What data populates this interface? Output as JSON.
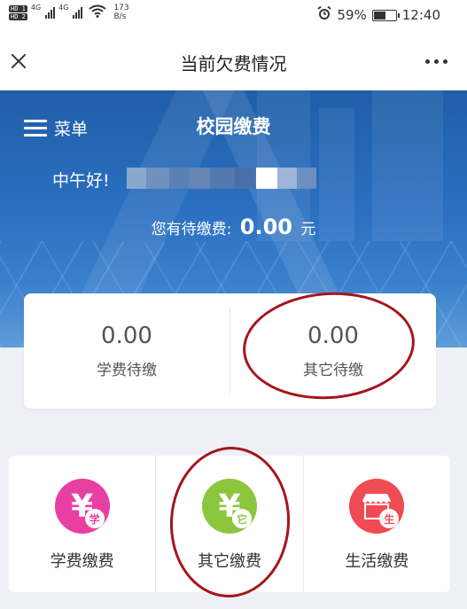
{
  "status_bar": {
    "hd1": "HD 1",
    "hd2": "HD 2",
    "net1": "4G",
    "net2": "4G",
    "speed_value": "173",
    "speed_unit": "B/s",
    "battery": "59%",
    "battery_level": 0.59,
    "time": "12:40"
  },
  "titlebar": {
    "title": "当前欠费情况"
  },
  "banner": {
    "menu_label": "菜单",
    "brand": "校园缴费",
    "greeting": "中午好!",
    "pending_label": "您有待缴费:",
    "pending_amount": "0.00",
    "pending_unit": "元"
  },
  "summary": {
    "tuition_value": "0.00",
    "tuition_label": "学费待缴",
    "other_value": "0.00",
    "other_label": "其它待缴"
  },
  "services": [
    {
      "label": "学费缴费",
      "glyph": "¥",
      "badge": "学",
      "color": "#e83fa3",
      "icon": "tuition-yen-icon"
    },
    {
      "label": "其它缴费",
      "glyph": "¥",
      "badge": "它",
      "color": "#8cc63f",
      "icon": "other-yen-icon"
    },
    {
      "label": "生活缴费",
      "glyph": "",
      "badge": "生",
      "color": "#ef4b53",
      "icon": "storefront-icon"
    }
  ],
  "colors": {
    "banner_blue": "#2a6fc0",
    "annotation_ring": "#a4161c"
  }
}
